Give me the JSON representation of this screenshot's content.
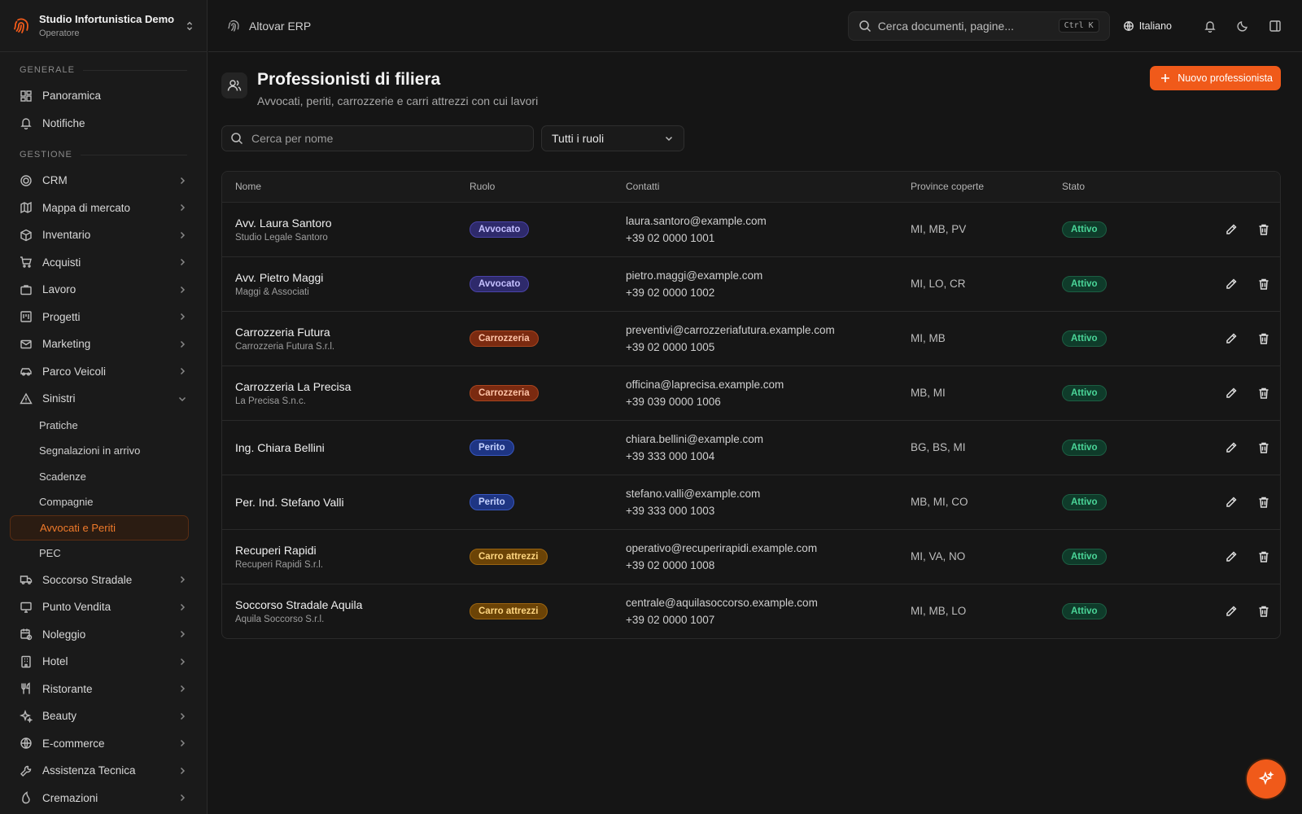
{
  "org": {
    "name": "Studio Infortunistica Demo",
    "role": "Operatore"
  },
  "sidebar": {
    "section_general": "GENERALE",
    "general_items": [
      {
        "label": "Panoramica",
        "icon": "dashboard-icon"
      },
      {
        "label": "Notifiche",
        "icon": "bell-icon"
      }
    ],
    "section_manage": "GESTIONE",
    "manage_items": [
      {
        "label": "CRM"
      },
      {
        "label": "Mappa di mercato"
      },
      {
        "label": "Inventario"
      },
      {
        "label": "Acquisti"
      },
      {
        "label": "Lavoro"
      },
      {
        "label": "Progetti"
      },
      {
        "label": "Marketing"
      },
      {
        "label": "Parco Veicoli"
      },
      {
        "label": "Sinistri"
      }
    ],
    "sinistri_sub": [
      "Pratiche",
      "Segnalazioni in arrivo",
      "Scadenze",
      "Compagnie",
      "Avvocati e Periti",
      "PEC"
    ],
    "after_items": [
      {
        "label": "Soccorso Stradale"
      },
      {
        "label": "Punto Vendita"
      },
      {
        "label": "Noleggio"
      },
      {
        "label": "Hotel"
      },
      {
        "label": "Ristorante"
      },
      {
        "label": "Beauty"
      },
      {
        "label": "E-commerce"
      },
      {
        "label": "Assistenza Tecnica"
      },
      {
        "label": "Cremazioni"
      }
    ]
  },
  "topbar": {
    "brand": "Altovar ERP",
    "search_placeholder": "Cerca documenti, pagine...",
    "search_shortcut": "Ctrl K",
    "language": "Italiano"
  },
  "page": {
    "title": "Professionisti di filiera",
    "description": "Avvocati, periti, carrozzerie e carri attrezzi con cui lavori",
    "new_button": "Nuovo professionista",
    "filter_placeholder": "Cerca per nome",
    "role_filter": "Tutti i ruoli"
  },
  "table": {
    "headers": {
      "name": "Nome",
      "role": "Ruolo",
      "contacts": "Contatti",
      "provinces": "Province coperte",
      "status": "Stato"
    },
    "rows": [
      {
        "name": "Avv. Laura Santoro",
        "org": "Studio Legale Santoro",
        "role": "Avvocato",
        "role_class": "b-avv",
        "email": "laura.santoro@example.com",
        "phone": "+39 02 0000 1001",
        "provinces": "MI, MB, PV",
        "status": "Attivo"
      },
      {
        "name": "Avv. Pietro Maggi",
        "org": "Maggi & Associati",
        "role": "Avvocato",
        "role_class": "b-avv",
        "email": "pietro.maggi@example.com",
        "phone": "+39 02 0000 1002",
        "provinces": "MI, LO, CR",
        "status": "Attivo"
      },
      {
        "name": "Carrozzeria Futura",
        "org": "Carrozzeria Futura S.r.l.",
        "role": "Carrozzeria",
        "role_class": "b-car",
        "email": "preventivi@carrozzeriafutura.example.com",
        "phone": "+39 02 0000 1005",
        "provinces": "MI, MB",
        "status": "Attivo"
      },
      {
        "name": "Carrozzeria La Precisa",
        "org": "La Precisa S.n.c.",
        "role": "Carrozzeria",
        "role_class": "b-car",
        "email": "officina@laprecisa.example.com",
        "phone": "+39 039 0000 1006",
        "provinces": "MB, MI",
        "status": "Attivo"
      },
      {
        "name": "Ing. Chiara Bellini",
        "org": "",
        "role": "Perito",
        "role_class": "b-per",
        "email": "chiara.bellini@example.com",
        "phone": "+39 333 000 1004",
        "provinces": "BG, BS, MI",
        "status": "Attivo"
      },
      {
        "name": "Per. Ind. Stefano Valli",
        "org": "",
        "role": "Perito",
        "role_class": "b-per",
        "email": "stefano.valli@example.com",
        "phone": "+39 333 000 1003",
        "provinces": "MB, MI, CO",
        "status": "Attivo"
      },
      {
        "name": "Recuperi Rapidi",
        "org": "Recuperi Rapidi S.r.l.",
        "role": "Carro attrezzi",
        "role_class": "b-atz",
        "email": "operativo@recuperirapidi.example.com",
        "phone": "+39 02 0000 1008",
        "provinces": "MI, VA, NO",
        "status": "Attivo"
      },
      {
        "name": "Soccorso Stradale Aquila",
        "org": "Aquila Soccorso S.r.l.",
        "role": "Carro attrezzi",
        "role_class": "b-atz",
        "email": "centrale@aquilasoccorso.example.com",
        "phone": "+39 02 0000 1007",
        "provinces": "MI, MB, LO",
        "status": "Attivo"
      }
    ]
  },
  "colors": {
    "accent": "#f05a1a",
    "active_status": "#4ad598"
  }
}
